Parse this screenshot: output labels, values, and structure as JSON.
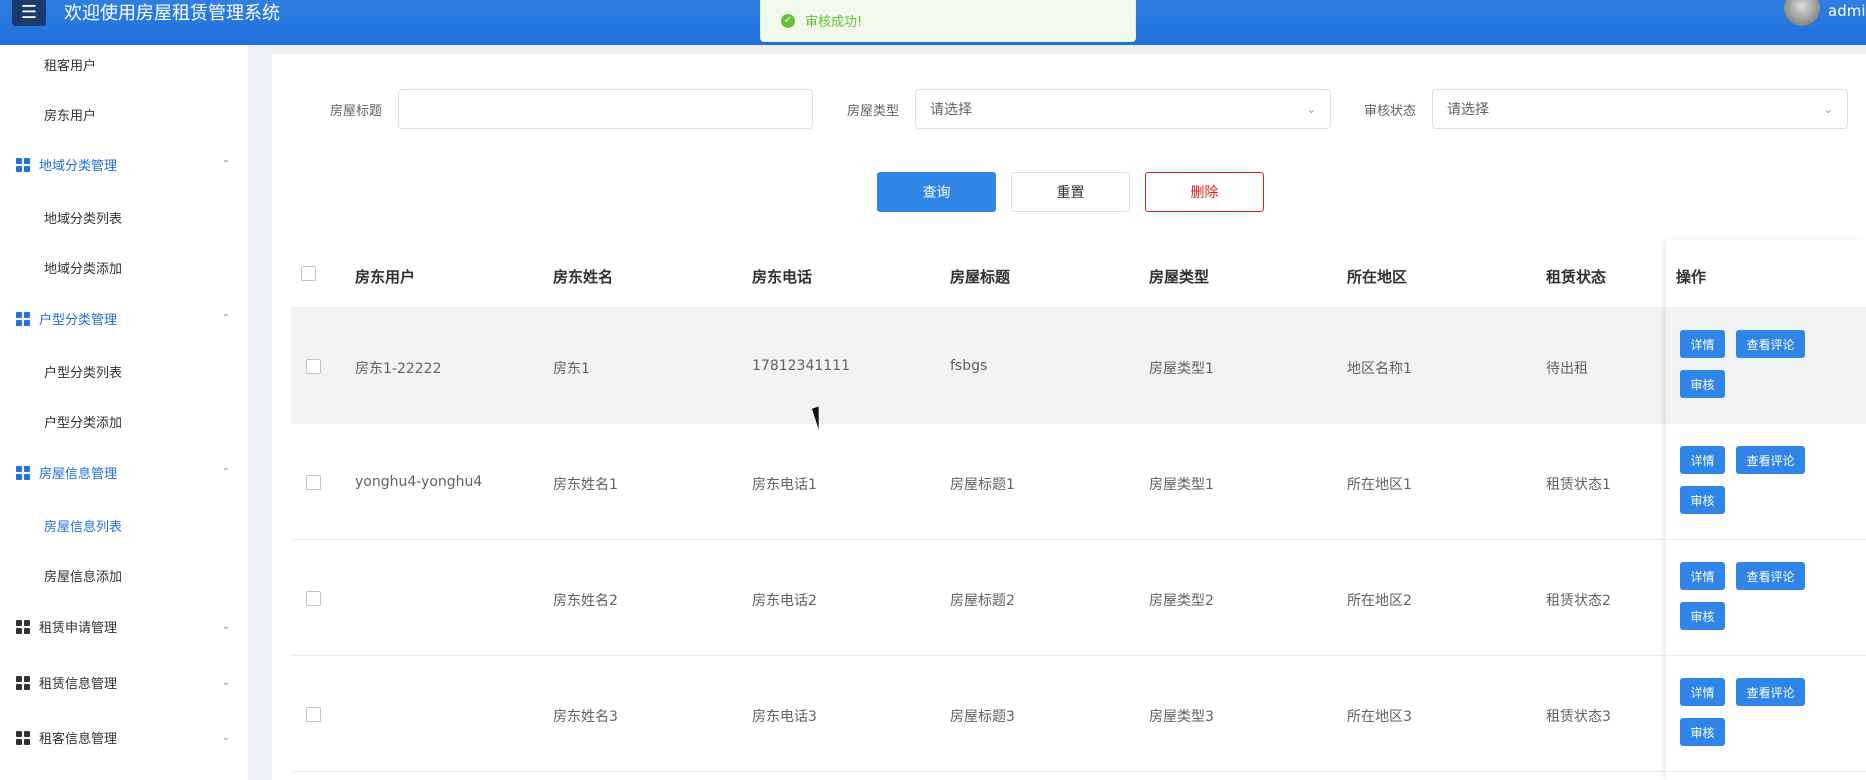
{
  "header": {
    "title": "欢迎使用房屋租赁管理系统",
    "user": "admin",
    "menu_icon": "hamburger-icon",
    "bg_color": "#1f6fdc"
  },
  "toast": {
    "text": "审核成功!",
    "color": "#67c23a"
  },
  "sidebar": {
    "items": [
      {
        "type": "sub",
        "label": "租客用户"
      },
      {
        "type": "sub",
        "label": "房东用户"
      },
      {
        "type": "group",
        "label": "地域分类管理",
        "open": true
      },
      {
        "type": "sub",
        "label": "地域分类列表"
      },
      {
        "type": "sub",
        "label": "地域分类添加"
      },
      {
        "type": "group",
        "label": "户型分类管理",
        "open": true
      },
      {
        "type": "sub",
        "label": "户型分类列表"
      },
      {
        "type": "sub",
        "label": "户型分类添加"
      },
      {
        "type": "group",
        "label": "房屋信息管理",
        "open": true
      },
      {
        "type": "sub",
        "label": "房屋信息列表",
        "active": true
      },
      {
        "type": "sub",
        "label": "房屋信息添加"
      },
      {
        "type": "group",
        "label": "租赁申请管理",
        "open": false
      },
      {
        "type": "group",
        "label": "租赁信息管理",
        "open": false
      },
      {
        "type": "group",
        "label": "租客信息管理",
        "open": false
      }
    ]
  },
  "search": {
    "title_label": "房屋标题",
    "title_value": "",
    "type_label": "房屋类型",
    "type_placeholder": "请选择",
    "audit_label": "审核状态",
    "audit_placeholder": "请选择"
  },
  "actions": {
    "query": "查询",
    "reset": "重置",
    "delete": "删除"
  },
  "table": {
    "headers": [
      "房东用户",
      "房东姓名",
      "房东电话",
      "房屋标题",
      "房屋类型",
      "所在地区",
      "租赁状态",
      "操作"
    ],
    "rows": [
      [
        "房东1-22222",
        "房东1",
        "17812341111",
        "fsbgs",
        "房屋类型1",
        "地区名称1",
        "待出租"
      ],
      [
        "yonghu4-yonghu4",
        "房东姓名1",
        "房东电话1",
        "房屋标题1",
        "房屋类型1",
        "所在地区1",
        "租赁状态1"
      ],
      [
        "",
        "房东姓名2",
        "房东电话2",
        "房屋标题2",
        "房屋类型2",
        "所在地区2",
        "租赁状态2"
      ],
      [
        "",
        "房东姓名3",
        "房东电话3",
        "房屋标题3",
        "房屋类型3",
        "所在地区3",
        "租赁状态3"
      ]
    ],
    "row_actions": {
      "detail": "详情",
      "comments": "查看评论",
      "audit": "审核"
    }
  }
}
